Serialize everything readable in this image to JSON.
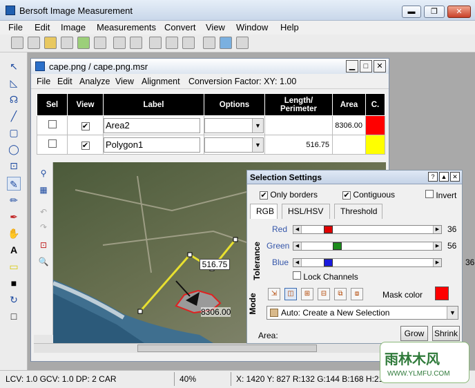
{
  "app": {
    "title": "Bersoft Image Measurement",
    "window_buttons": [
      "▬",
      "❐",
      "✕"
    ]
  },
  "menu": [
    "File",
    "Edit",
    "Image",
    "Measurements",
    "Convert",
    "View",
    "Window",
    "Help"
  ],
  "document": {
    "title": "cape.png / cape.png.msr",
    "menu": [
      "File",
      "Edit",
      "Analyze",
      "View",
      "Alignment",
      "Conversion Factor: XY: 1.00"
    ],
    "columns": [
      "Sel",
      "View",
      "Label",
      "Options",
      "Length/ Perimeter",
      "Area",
      "C."
    ],
    "rows": [
      {
        "sel": "",
        "view": "✔",
        "label": "Area2",
        "length": "",
        "area": "8306.00",
        "color": "#ff0000"
      },
      {
        "sel": "",
        "view": "✔",
        "label": "Polygon1",
        "length": "516.75",
        "area": "",
        "color": "#ffff00"
      }
    ],
    "image_labels": {
      "length": "516.75",
      "area": "8306.00"
    }
  },
  "selection_settings": {
    "title": "Selection Settings",
    "options": [
      {
        "label": "Only borders",
        "checked": true
      },
      {
        "label": "Contiguous",
        "checked": true
      },
      {
        "label": "Invert",
        "checked": false
      }
    ],
    "tabs": [
      "RGB",
      "HSL/HSV",
      "Threshold"
    ],
    "tolerance_label": "Tolerance",
    "sliders": [
      {
        "name": "Red",
        "value": "36",
        "color": "#e00000",
        "fraction": 0.18
      },
      {
        "name": "Green",
        "value": "56",
        "color": "#1c8c1c",
        "fraction": 0.25
      },
      {
        "name": "Blue",
        "value": "36",
        "color": "#1a1adf",
        "fraction": 0.18
      }
    ],
    "lock_channels": "Lock Channels",
    "mode_label": "Mode",
    "mask_color_label": "Mask color",
    "mask_color": "#ff0000",
    "mode_select": "Auto: Create a New Selection",
    "area_label": "Area:",
    "grow": "Grow",
    "shrink": "Shrink"
  },
  "status": {
    "left": "LCV: 1.0 GCV: 1.0 DP: 2  CAR",
    "zoom": "40%",
    "coords": "X: 1420 Y: 827  R:132 G:144 B:168  H:219"
  },
  "watermark": {
    "text": "雨林木风",
    "url": "WWW.YLMFU.COM"
  }
}
